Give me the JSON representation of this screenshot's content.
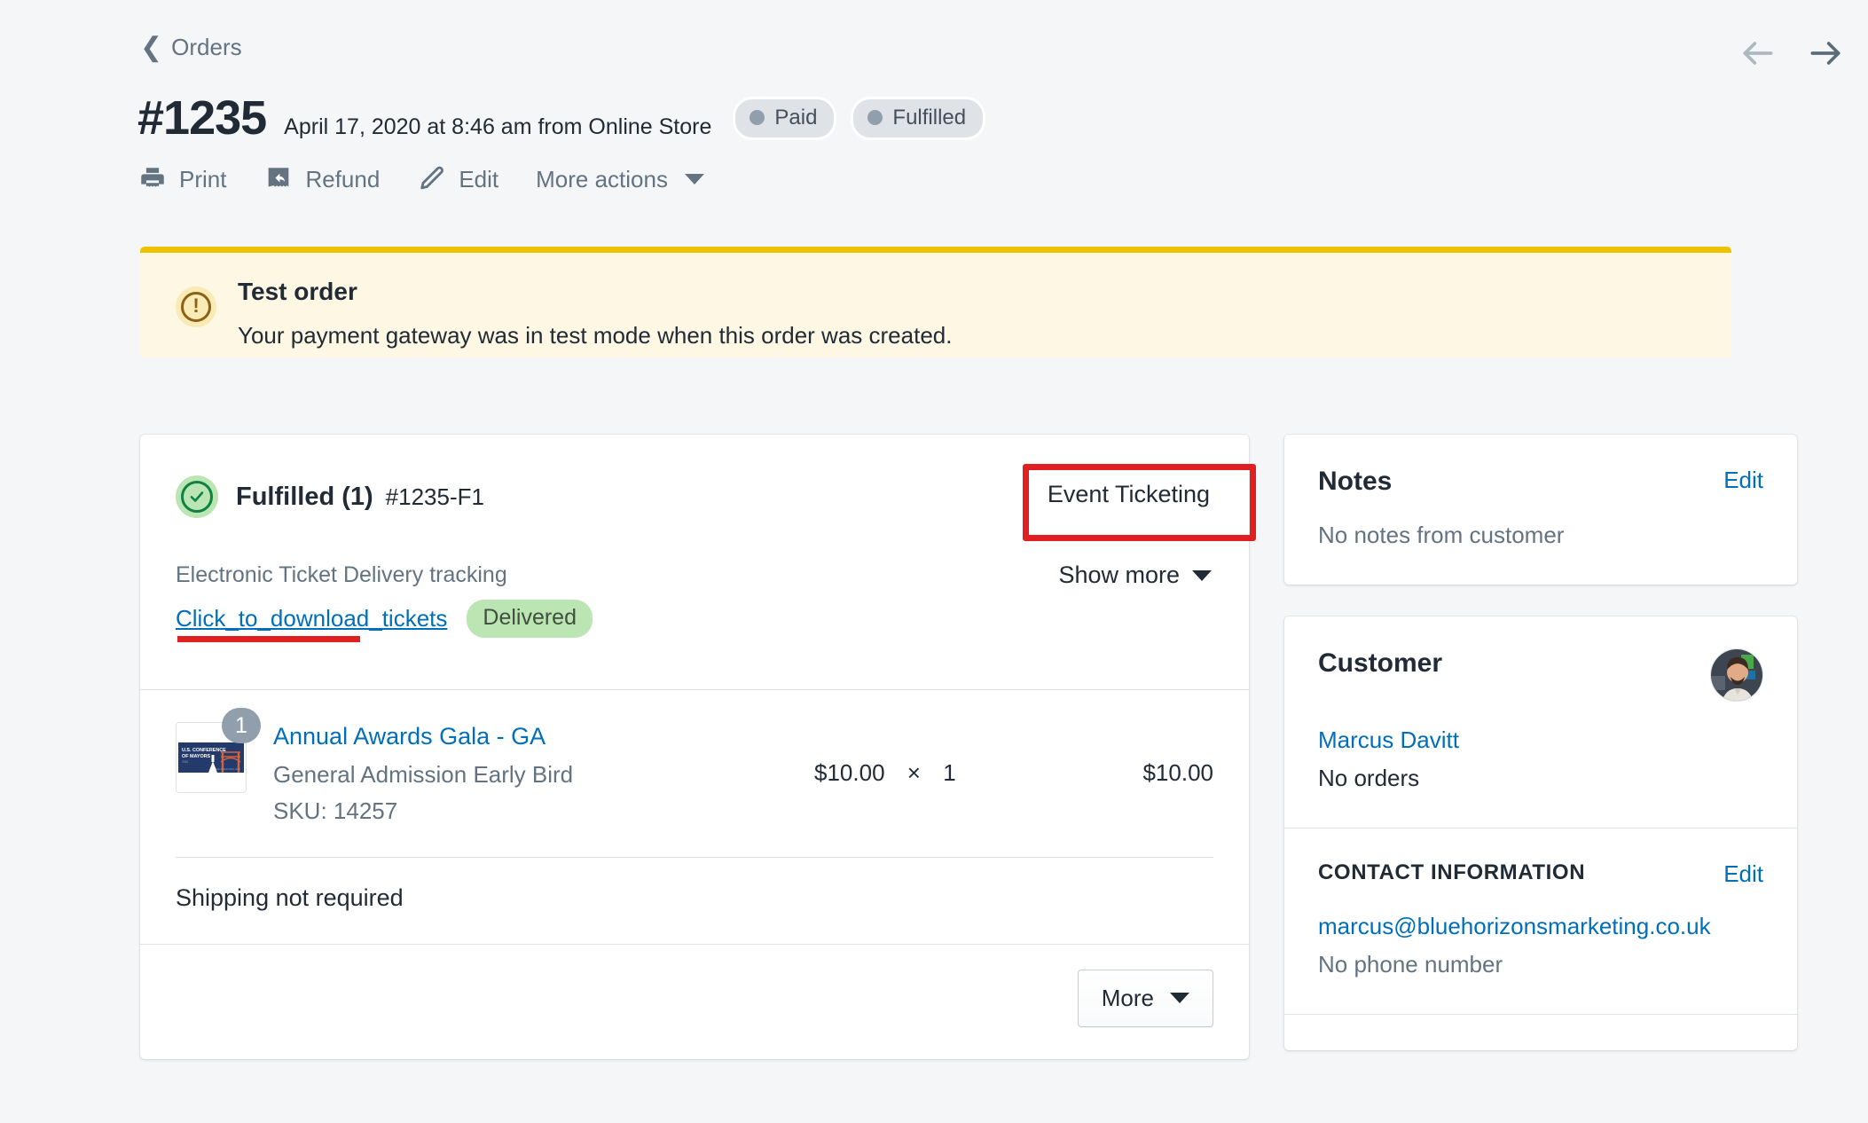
{
  "header": {
    "breadcrumb": "Orders",
    "order_number": "#1235",
    "order_meta": "April 17, 2020 at 8:46 am from Online Store",
    "badges": [
      {
        "label": "Paid"
      },
      {
        "label": "Fulfilled"
      }
    ],
    "nav": {
      "prev_icon": "arrow-left-icon",
      "next_icon": "arrow-right-icon"
    }
  },
  "actions": [
    {
      "label": "Print",
      "icon": "printer-icon"
    },
    {
      "label": "Refund",
      "icon": "refund-icon"
    },
    {
      "label": "Edit",
      "icon": "pencil-icon"
    },
    {
      "label": "More actions",
      "icon": "chevron-down-icon"
    }
  ],
  "banner": {
    "icon": "alert-circle-icon",
    "title": "Test order",
    "body": "Your payment gateway was in test mode when this order was created.",
    "accent_color": "#eec200",
    "background_color": "#fdf7e3"
  },
  "fulfillment": {
    "status_icon": "check-circle-icon",
    "title": "Fulfilled (1)",
    "fulfillment_id": "#1235-F1",
    "app_name": "Event Ticketing",
    "tracking_label": "Electronic Ticket Delivery tracking",
    "tracking_link": "Click_to_download_tickets",
    "tracking_status": "Delivered",
    "show_more_label": "Show more",
    "line_items": [
      {
        "quantity_badge": "1",
        "title": "Annual Awards Gala - GA",
        "variant": "General Admission Early Bird",
        "sku": "SKU: 14257",
        "unit_price": "$10.00",
        "times": "×",
        "quantity": "1",
        "total": "$10.00",
        "thumbnail_alt": "U.S. CONFERENCE OF MAYORS"
      }
    ],
    "shipping_note": "Shipping not required",
    "more_button": "More"
  },
  "notes": {
    "title": "Notes",
    "edit_label": "Edit",
    "empty_text": "No notes from customer"
  },
  "customer": {
    "title": "Customer",
    "avatar": "customer-avatar",
    "name": "Marcus Davitt",
    "orders_text": "No orders",
    "contact": {
      "title": "CONTACT INFORMATION",
      "edit_label": "Edit",
      "email": "marcus@bluehorizonsmarketing.co.uk",
      "phone": "No phone number"
    }
  },
  "annotations": {
    "box_target": "Event Ticketing",
    "underline_target": "Click_to_download_tickets",
    "color": "#e02020"
  }
}
